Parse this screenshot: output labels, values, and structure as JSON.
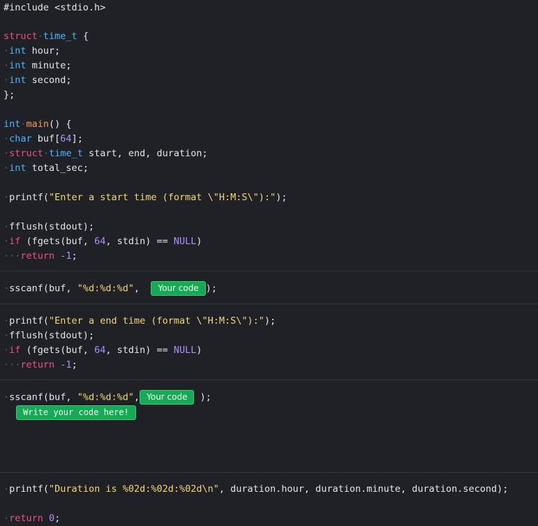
{
  "code": {
    "l01": "#include <stdio.h>",
    "l03_kw": "struct",
    "l03_ty": "time_t",
    "l03_rest": " {",
    "l04_ty": "int",
    "l04_rest": " hour;",
    "l05_ty": "int",
    "l05_rest": " minute;",
    "l06_ty": "int",
    "l06_rest": " second;",
    "l07": "};",
    "l09_ty": "int",
    "l09_fn": "main",
    "l09_rest": "() {",
    "l10_ty": "char",
    "l10_a": " buf[",
    "l10_n": "64",
    "l10_b": "];",
    "l11_kw": "struct",
    "l11_ty": "time_t",
    "l11_rest": " start, end, duration;",
    "l12_ty": "int",
    "l12_rest": " total_sec;",
    "l14_a": "printf(",
    "l14_s": "\"Enter a start time (format \\\"H:M:S\\\"):\"",
    "l14_b": ");",
    "l16": "fflush(stdout);",
    "l17_kw": "if",
    "l17_a": " (fgets(buf, ",
    "l17_n": "64",
    "l17_b": ", stdin) == ",
    "l17_nu": "NULL",
    "l17_c": ")",
    "l18_kw": "return",
    "l18_n": " -1",
    "l18_c": ";",
    "l20_a": "sscanf(buf, ",
    "l20_s": "\"%d:%d:%d\"",
    "l20_b": ", ",
    "l20_c": ");",
    "l22_a": "printf(",
    "l22_s": "\"Enter a end time (format \\\"H:M:S\\\"):\"",
    "l22_b": ");",
    "l23": "fflush(stdout);",
    "l24_kw": "if",
    "l24_a": " (fgets(buf, ",
    "l24_n": "64",
    "l24_b": ", stdin) == ",
    "l24_nu": "NULL",
    "l24_c": ")",
    "l25_kw": "return",
    "l25_n": " -1",
    "l25_c": ";",
    "l27_a": "sscanf(buf, ",
    "l27_s": "\"%d:%d:%d\"",
    "l27_b": ",",
    "l27_c": " );",
    "l30_a": "printf(",
    "l30_s": "\"Duration is %02d:%02d:%02d\\n\"",
    "l30_b": ", duration.hour, duration.minute, duration.second);",
    "l32_kw": "return",
    "l32_n": " 0",
    "l32_c": ";"
  },
  "buttons": {
    "your_code_1": "Your code",
    "your_code_2": "Your code",
    "write_here": "Write your code here!"
  },
  "indent_dot": "·"
}
